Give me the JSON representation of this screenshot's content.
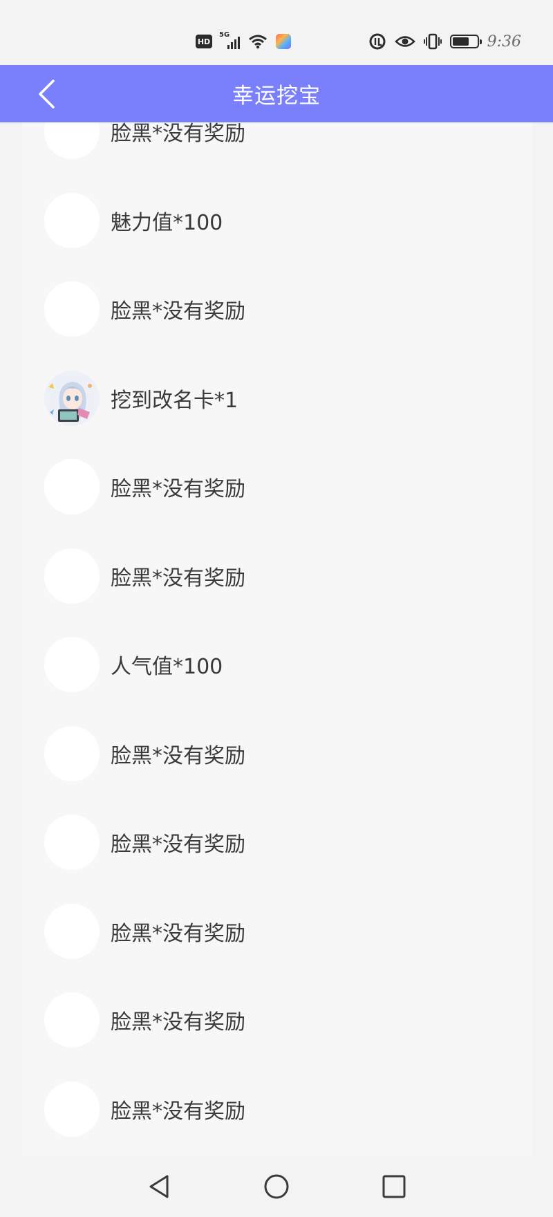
{
  "status_bar": {
    "time": "9:36",
    "hd_label": "HD",
    "network_label": "5G",
    "battery_level": 0.7,
    "icons": [
      "hd-icon",
      "signal-5g-icon",
      "wifi-icon",
      "app-notification-icon",
      "data-saver-icon",
      "eye-comfort-icon",
      "vibrate-icon",
      "battery-icon"
    ]
  },
  "app_bar": {
    "title": "幸运挖宝",
    "back_icon": "chevron-left-icon",
    "background": "#7a80fb"
  },
  "records": [
    {
      "text": "脸黑*没有奖励",
      "avatar": "blank"
    },
    {
      "text": "魅力值*100",
      "avatar": "blank"
    },
    {
      "text": "脸黑*没有奖励",
      "avatar": "blank"
    },
    {
      "text": "挖到改名卡*1",
      "avatar": "anime-girl"
    },
    {
      "text": "脸黑*没有奖励",
      "avatar": "blank"
    },
    {
      "text": "脸黑*没有奖励",
      "avatar": "blank"
    },
    {
      "text": "人气值*100",
      "avatar": "blank"
    },
    {
      "text": "脸黑*没有奖励",
      "avatar": "blank"
    },
    {
      "text": "脸黑*没有奖励",
      "avatar": "blank"
    },
    {
      "text": "脸黑*没有奖励",
      "avatar": "blank"
    },
    {
      "text": "脸黑*没有奖励",
      "avatar": "blank"
    },
    {
      "text": "脸黑*没有奖励",
      "avatar": "blank"
    }
  ],
  "nav_bar": {
    "icons": [
      "back-triangle-icon",
      "home-circle-icon",
      "recents-square-icon"
    ]
  }
}
